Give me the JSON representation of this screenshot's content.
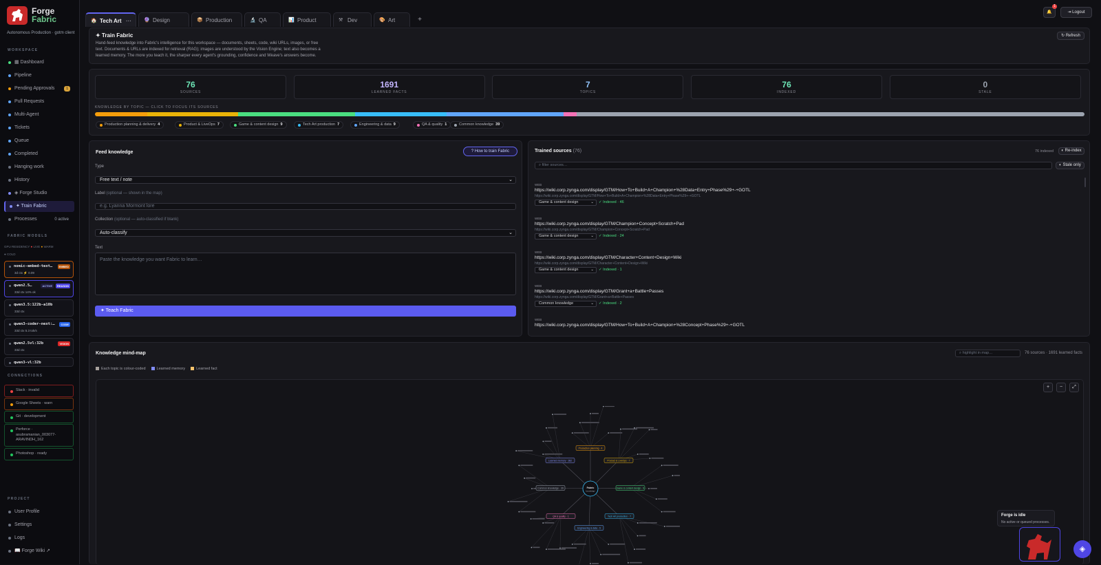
{
  "app": {
    "name_1": "Forge",
    "name_2": "Fabric",
    "subtitle": "Autonomous Production · gotm client"
  },
  "sidebar": {
    "workspace_heading": "WORKSPACE",
    "items": [
      {
        "label": "▦ Dashboard",
        "color": "#4ade80"
      },
      {
        "label": "Pipeline",
        "color": "#60a5fa"
      },
      {
        "label": "Pending Approvals",
        "color": "#f59e0b",
        "badge": "1"
      },
      {
        "label": "Pull Requests",
        "color": "#60a5fa"
      },
      {
        "label": "Multi-Agent",
        "color": "#60a5fa"
      },
      {
        "label": "Tickets",
        "color": "#60a5fa"
      },
      {
        "label": "Queue",
        "color": "#60a5fa"
      },
      {
        "label": "Completed",
        "color": "#60a5fa"
      },
      {
        "label": "Hanging work",
        "color": "#6b7280"
      },
      {
        "label": "History",
        "color": "#6b7280"
      },
      {
        "label": "◈ Forge Studio",
        "color": "#818cf8"
      },
      {
        "label": "✦ Train Fabric",
        "color": "#818cf8"
      },
      {
        "label": "Processes",
        "color": "#6b7280",
        "extra": "0 active"
      }
    ],
    "models_heading": "FABRIC MODELS",
    "gpu_residency": "GPU RESIDENCY",
    "legend_live": "LIVE",
    "legend_warm": "WARM",
    "cold": "● COLD",
    "models": [
      {
        "name": "nomic-embed-text…",
        "tag": "EMBED",
        "tag_color": "#b45309",
        "stats": "3d ctx  ⚡ 0.09",
        "border": "#b45309"
      },
      {
        "name": "qwen2.5…",
        "tag": "REASON",
        "tag_color": "#4f46e5",
        "tag2": "ACTIVE",
        "stats": "33d ctx  14% ok",
        "border": "#4f46e5"
      },
      {
        "name": "qwen3.5:122b-a10b",
        "tag": "",
        "tag_color": "",
        "stats": "33d ctx",
        "border": "#2a2a33"
      },
      {
        "name": "qwen3-coder-next:…",
        "tag": "CODE",
        "tag_color": "#2563eb",
        "stats": "33d ctx  5.3 tok/s",
        "border": "#2a2a33"
      },
      {
        "name": "qwen2.5vl:32b",
        "tag": "VISION",
        "tag_color": "#dc2626",
        "stats": "33d ctx",
        "border": "#2a2a33"
      },
      {
        "name": "qwen3-vl:32b",
        "tag": "",
        "tag_color": "",
        "stats": "",
        "border": "#2a2a33"
      }
    ],
    "connections_heading": "CONNECTIONS",
    "connections": [
      {
        "label": "Slack · invalid",
        "color": "#ef4444",
        "border": "#7f1d1d"
      },
      {
        "label": "Google Sheets · warn",
        "color": "#f59e0b",
        "border": "#78350f"
      },
      {
        "label": "Git · development",
        "color": "#22c55e",
        "border": "#14532d"
      },
      {
        "label": "Perforce · asubramanian_003077-ARAVINDH_162",
        "color": "#22c55e",
        "border": "#14532d"
      },
      {
        "label": "Photoshop · ready",
        "color": "#22c55e",
        "border": "#14532d"
      }
    ],
    "project_heading": "PROJECT",
    "project_items": [
      "User Profile",
      "Settings",
      "Logs",
      "📖 Forge Wiki ↗"
    ]
  },
  "tabs": [
    {
      "icon": "🏠",
      "label": "Tech Art"
    },
    {
      "icon": "🔮",
      "label": "Design"
    },
    {
      "icon": "📦",
      "label": "Production"
    },
    {
      "icon": "🔬",
      "label": "QA"
    },
    {
      "icon": "📊",
      "label": "Product"
    },
    {
      "icon": "⚒",
      "label": "Dev"
    },
    {
      "icon": "🎨",
      "label": "Art"
    }
  ],
  "tab_add": "+",
  "tab_more": "···",
  "header": {
    "notif_count": "1",
    "logout": "⇥ Logout"
  },
  "train": {
    "title": "✦ Train Fabric",
    "refresh": "↻ Refresh",
    "desc1": "Hand-feed knowledge into Fabric's intelligence for this workspace — documents, sheets, code, wiki URLs, images, or free",
    "desc2": "text. Documents & URLs are indexed for retrieval (RAG); images are understood by the Vision Engine; text also becomes a",
    "desc3": "learned memory. The more you teach it, the sharper every agent's grounding, confidence and Weave's answers become."
  },
  "stats": [
    {
      "value": "76",
      "label": "SOURCES",
      "color": "#6ee7b7"
    },
    {
      "value": "1691",
      "label": "LEARNED FACTS",
      "color": "#c4b5fd"
    },
    {
      "value": "7",
      "label": "TOPICS",
      "color": "#93c5fd"
    },
    {
      "value": "76",
      "label": "INDEXED",
      "color": "#6ee7b7"
    },
    {
      "value": "0",
      "label": "STALE",
      "color": "#9ca3af"
    }
  ],
  "topics_heading": "KNOWLEDGE BY TOPIC — CLICK TO FOCUS ITS SOURCES",
  "topics": [
    {
      "label": "Production planning & delivery",
      "count": 4,
      "color": "#f59e0b"
    },
    {
      "label": "Product & LiveOps",
      "count": 7,
      "color": "#eab308"
    },
    {
      "label": "Game & content design",
      "count": 9,
      "color": "#4ade80"
    },
    {
      "label": "Tech Art production",
      "count": 7,
      "color": "#38bdf8"
    },
    {
      "label": "Engineering & data",
      "count": 9,
      "color": "#60a5fa"
    },
    {
      "label": "QA & quality",
      "count": 1,
      "color": "#f472b6"
    },
    {
      "label": "Common knowledge",
      "count": 39,
      "color": "#9ca3af"
    }
  ],
  "feed": {
    "title": "Feed knowledge",
    "how_to": "? How to train Fabric",
    "type_label": "Type",
    "type_value": "Free text / note",
    "label_label": "Label",
    "label_hint": "(optional — shown in the map)",
    "label_placeholder": "e.g. Lyanna Mormont lore",
    "collection_label": "Collection",
    "collection_hint": "(optional — auto-classified if blank)",
    "collection_value": "Auto-classify",
    "text_label": "Text",
    "text_placeholder": "Paste the knowledge you want Fabric to learn…",
    "submit": "✦ Teach Fabric"
  },
  "trained": {
    "title": "Trained sources",
    "count": "(76)",
    "indexed": "76 indexed",
    "reindex": "◐ Re-index",
    "filter_placeholder": "⌕ filter sources…",
    "stale_only": "◐ Stale only",
    "sources": [
      {
        "kind": "WEB",
        "url": "https://wiki.corp.zynga.com/display/GTM/How+To+Build+A+Champion+%28Data+Entry+Phase%29+-+GOTL",
        "sub": "https://wiki.corp.zynga.com/display/GTM/How+To+Build+A+Champion+%28Data+Entry+Phase%29+-+GOTL",
        "topic": "Game & content design",
        "indexed": "✓ Indexed · 46"
      },
      {
        "kind": "WEB",
        "url": "https://wiki.corp.zynga.com/display/GTM/Champion+Concept+Scratch+Pad",
        "sub": "https://wiki.corp.zynga.com/display/GTM/Champion+Concept+Scratch+Pad",
        "topic": "Game & content design",
        "indexed": "✓ Indexed · 24"
      },
      {
        "kind": "WEB",
        "url": "https://wiki.corp.zynga.com/display/GTM/Character+Content+Design+Wiki",
        "sub": "https://wiki.corp.zynga.com/display/GTM/Character+Content+Design+Wiki",
        "topic": "Game & content design",
        "indexed": "✓ Indexed · 1"
      },
      {
        "kind": "WEB",
        "url": "https://wiki.corp.zynga.com/display/GTM/Grant+a+Battle+Passes",
        "sub": "https://wiki.corp.zynga.com/display/GTM/Grant+a+Battle+Passes",
        "topic": "Common knowledge",
        "indexed": "✓ Indexed · 2"
      },
      {
        "kind": "WEB",
        "url": "https://wiki.corp.zynga.com/display/GTM/How+To+Build+A+Champion+%28Concept+Phase%29+-+GOTL",
        "sub": "",
        "topic": "",
        "indexed": ""
      }
    ]
  },
  "mindmap": {
    "title": "Knowledge mind-map",
    "highlight_placeholder": "⌕ highlight in map…",
    "summary": "76 sources · 1691 learned facts",
    "legend": [
      {
        "label": "Each topic is colour-coded",
        "color": "#a8a29e"
      },
      {
        "label": "Learned memory",
        "color": "#818cf8"
      },
      {
        "label": "Learned fact",
        "color": "#f5c26b"
      }
    ],
    "center_title": "Fabric",
    "center_sub": "knowledge",
    "nodes": [
      {
        "label": "Production planning · 4",
        "color": "#f59e0b"
      },
      {
        "label": "Product & LiveOps · 7",
        "color": "#eab308"
      },
      {
        "label": "Game & content design · 9",
        "color": "#4ade80"
      },
      {
        "label": "Tech Art production · 7",
        "color": "#38bdf8"
      },
      {
        "label": "Engineering & data · 9",
        "color": "#60a5fa"
      },
      {
        "label": "QA & quality · 1",
        "color": "#f472b6"
      },
      {
        "label": "Common knowledge · 39",
        "color": "#9ca3af"
      },
      {
        "label": "Learned memory · 382",
        "color": "#818cf8"
      }
    ],
    "zoom_in": "+",
    "zoom_out": "−",
    "fit": "⤢"
  },
  "status": {
    "title": "Forge is idle",
    "sub": "No active or queued processes."
  }
}
